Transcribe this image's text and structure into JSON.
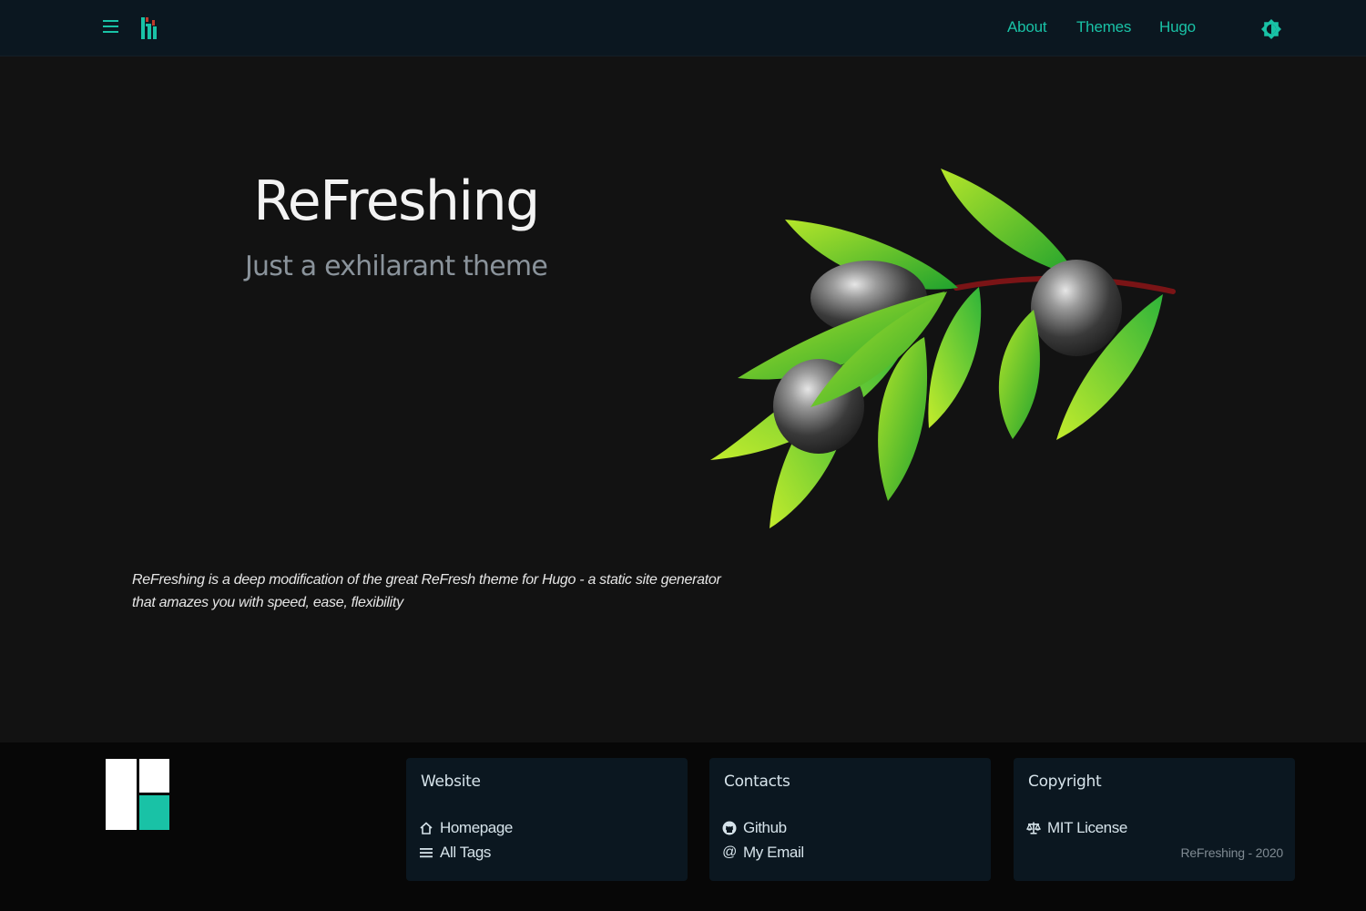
{
  "nav": {
    "links": [
      "About",
      "Themes",
      "Hugo"
    ]
  },
  "hero": {
    "title": "ReFreshing",
    "subtitle": "Just a exhilarant theme",
    "description_line1": "ReFreshing is a deep modification of the great ReFresh theme for Hugo - a static site generator",
    "description_line2": "that amazes you with speed, ease, flexibility"
  },
  "footer": {
    "website": {
      "title": "Website",
      "links": [
        "Homepage",
        "All Tags"
      ]
    },
    "contacts": {
      "title": "Contacts",
      "links": [
        "Github",
        "My Email"
      ]
    },
    "copyright": {
      "title": "Copyright",
      "license": "MIT License",
      "credit": "ReFreshing - 2020"
    }
  },
  "colors": {
    "accent": "#19c2a6",
    "navbar_bg": "#0b1720",
    "page_bg": "#121212",
    "footer_bg": "#070707"
  },
  "icons": [
    "menu-icon",
    "site-logo-icon",
    "theme-toggle-icon",
    "home-icon",
    "list-icon",
    "github-icon",
    "at-icon",
    "scale-icon"
  ]
}
